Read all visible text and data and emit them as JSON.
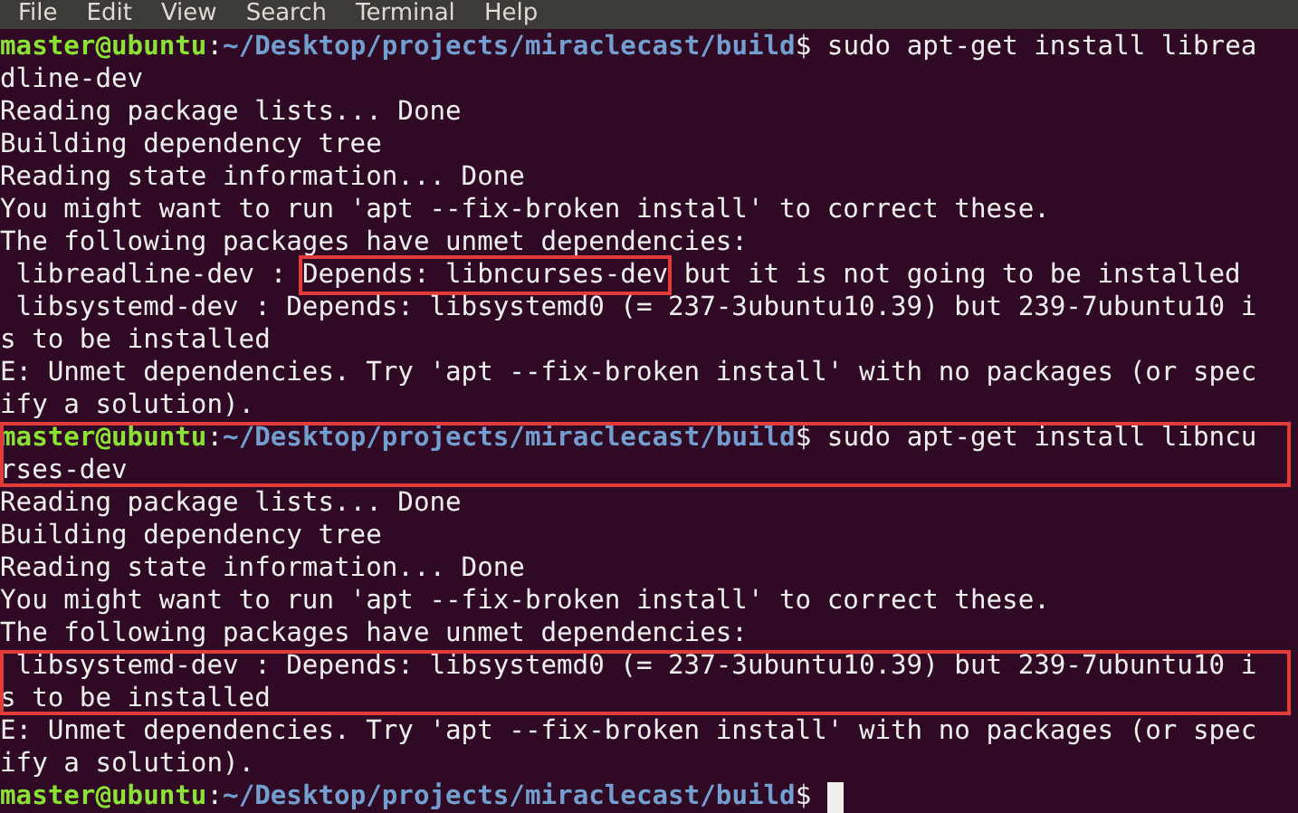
{
  "menu_bar": [
    "File",
    "Edit",
    "View",
    "Search",
    "Terminal",
    "Help"
  ],
  "blocks": [
    {
      "boxed": false,
      "lines": [
        [
          {
            "text": "master@ubuntu",
            "kind": "user"
          },
          {
            "text": ":",
            "kind": "text"
          },
          {
            "text": "~/Desktop/projects/miraclecast/build",
            "kind": "path"
          },
          {
            "text": "$ sudo apt-get install librea",
            "kind": "text"
          }
        ],
        [
          {
            "text": "dline-dev",
            "kind": "text"
          }
        ],
        [
          {
            "text": "Reading package lists... Done",
            "kind": "text"
          }
        ],
        [
          {
            "text": "Building dependency tree",
            "kind": "text"
          }
        ],
        [
          {
            "text": "Reading state information... Done",
            "kind": "text"
          }
        ],
        [
          {
            "text": "You might want to run 'apt --fix-broken install' to correct these.",
            "kind": "text"
          }
        ],
        [
          {
            "text": "The following packages have unmet dependencies:",
            "kind": "text"
          }
        ],
        [
          {
            "text": " libreadline-dev : ",
            "kind": "text",
            "boxed": false
          },
          {
            "text": "Depends: libncurses-dev",
            "kind": "text",
            "boxed": true
          },
          {
            "text": " but it is not going to be installed",
            "kind": "text",
            "boxed": false
          }
        ],
        [
          {
            "text": " libsystemd-dev : Depends: libsystemd0 (= 237-3ubuntu10.39) but 239-7ubuntu10 i",
            "kind": "text"
          }
        ],
        [
          {
            "text": "s to be installed",
            "kind": "text"
          }
        ],
        [
          {
            "text": "E: Unmet dependencies. Try 'apt --fix-broken install' with no packages (or spec",
            "kind": "text"
          }
        ],
        [
          {
            "text": "ify a solution).",
            "kind": "text"
          }
        ]
      ]
    },
    {
      "boxed": true,
      "lines": [
        [
          {
            "text": "master@ubuntu",
            "kind": "user"
          },
          {
            "text": ":",
            "kind": "text"
          },
          {
            "text": "~/Desktop/projects/miraclecast/build",
            "kind": "path"
          },
          {
            "text": "$ sudo apt-get install libncu",
            "kind": "text"
          }
        ],
        [
          {
            "text": "rses-dev",
            "kind": "text"
          }
        ]
      ]
    },
    {
      "boxed": false,
      "lines": [
        [
          {
            "text": "Reading package lists... Done",
            "kind": "text"
          }
        ],
        [
          {
            "text": "Building dependency tree",
            "kind": "text"
          }
        ],
        [
          {
            "text": "Reading state information... Done",
            "kind": "text"
          }
        ],
        [
          {
            "text": "You might want to run 'apt --fix-broken install' to correct these.",
            "kind": "text"
          }
        ],
        [
          {
            "text": "The following packages have unmet dependencies:",
            "kind": "text"
          }
        ]
      ]
    },
    {
      "boxed": true,
      "lines": [
        [
          {
            "text": " libsystemd-dev : Depends: libsystemd0 (= 237-3ubuntu10.39) but 239-7ubuntu10 i",
            "kind": "text"
          }
        ],
        [
          {
            "text": "s to be installed",
            "kind": "text"
          }
        ]
      ]
    },
    {
      "boxed": false,
      "lines": [
        [
          {
            "text": "E: Unmet dependencies. Try 'apt --fix-broken install' with no packages (or spec",
            "kind": "text"
          }
        ],
        [
          {
            "text": "ify a solution).",
            "kind": "text"
          }
        ],
        [
          {
            "text": "master@ubuntu",
            "kind": "user"
          },
          {
            "text": ":",
            "kind": "text"
          },
          {
            "text": "~/Desktop/projects/miraclecast/build",
            "kind": "path"
          },
          {
            "text": "$ ",
            "kind": "text"
          }
        ]
      ]
    }
  ],
  "cursor_visible": true
}
